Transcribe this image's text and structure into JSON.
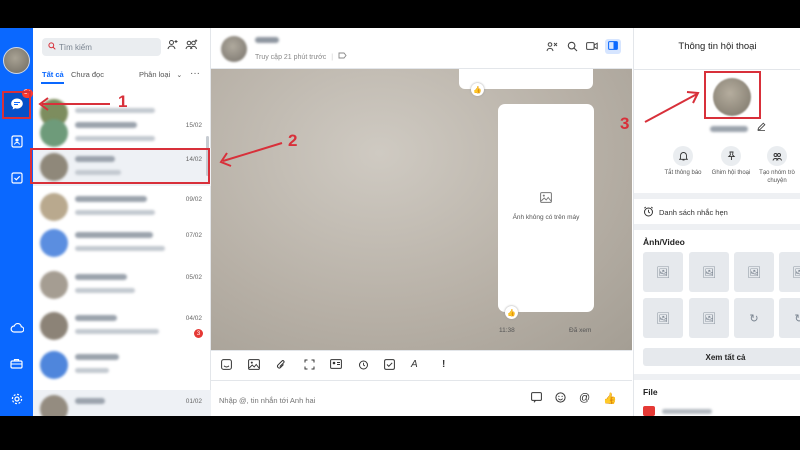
{
  "left_rail": {
    "chat_badge": "5+"
  },
  "conversation_list": {
    "search_placeholder": "Tìm kiếm",
    "tab_all": "Tất cả",
    "tab_unread": "Chưa đọc",
    "classify_label": "Phân loại",
    "more_label": "···",
    "rows": [
      {
        "date": ""
      },
      {
        "date": "15/02"
      },
      {
        "date": "14/02"
      },
      {
        "date": "09/02"
      },
      {
        "date": "07/02"
      },
      {
        "date": "05/02"
      },
      {
        "date": "04/02"
      },
      {
        "date": ""
      },
      {
        "date": "01/02"
      }
    ],
    "unread_count": "3"
  },
  "chat": {
    "status": "Truy cập 21 phút trước",
    "image_unavailable": "Ảnh không có trên máy",
    "message_time": "11:38",
    "seen_label": "Đã xem",
    "composer_placeholder": "Nhập @, tin nhắn tới Anh hai"
  },
  "info_panel": {
    "title": "Thông tin hội thoại",
    "actions": [
      {
        "label": "Tắt thông báo"
      },
      {
        "label": "Ghim hội thoại"
      },
      {
        "label": "Tạo nhóm trò chuyện"
      }
    ],
    "reminder_label": "Danh sách nhắc hẹn",
    "media_title": "Ảnh/Video",
    "see_all_label": "Xem tất cả",
    "file_title": "File"
  },
  "annotations": {
    "step1": "1",
    "step2": "2",
    "step3": "3"
  },
  "colors": {
    "accent": "#0a68ff",
    "annotation": "#d8303a"
  }
}
